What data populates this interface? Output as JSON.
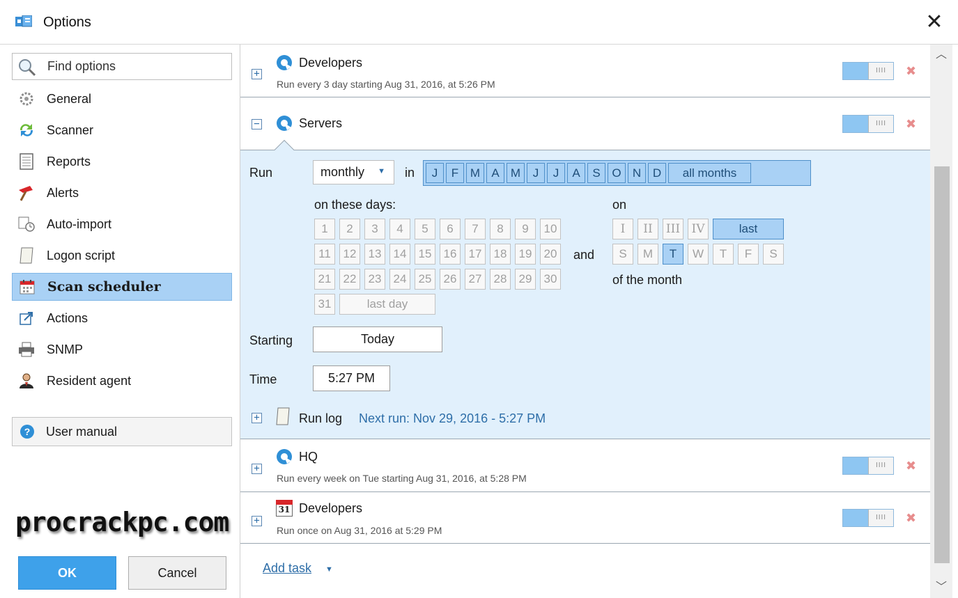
{
  "window": {
    "title": "Options",
    "close_symbol": "✕"
  },
  "sidebar": {
    "search_placeholder": "Find options",
    "items": [
      {
        "label": "General",
        "icon": "gear-icon"
      },
      {
        "label": "Scanner",
        "icon": "scanner-icon"
      },
      {
        "label": "Reports",
        "icon": "report-icon"
      },
      {
        "label": "Alerts",
        "icon": "alert-icon"
      },
      {
        "label": "Auto-import",
        "icon": "auto-import-icon"
      },
      {
        "label": "Logon script",
        "icon": "script-icon"
      },
      {
        "label": "Scan scheduler",
        "icon": "calendar-icon",
        "active": true
      },
      {
        "label": "Actions",
        "icon": "actions-icon"
      },
      {
        "label": "SNMP",
        "icon": "printer-icon"
      },
      {
        "label": "Resident agent",
        "icon": "agent-icon"
      }
    ],
    "user_manual": "User manual",
    "watermark": "procrackpc.com"
  },
  "buttons": {
    "ok": "OK",
    "cancel": "Cancel"
  },
  "tasks": [
    {
      "name": "Developers",
      "desc": "Run every 3 day starting Aug 31, 2016, at 5:26 PM",
      "icon": "refresh-icon",
      "expander": "+",
      "toggle": "IIII",
      "delete": "✖"
    },
    {
      "name": "Servers",
      "icon": "refresh-icon",
      "expander": "−",
      "toggle": "IIII",
      "delete": "✖"
    },
    {
      "name": "HQ",
      "desc": "Run every week on Tue starting Aug 31, 2016, at 5:28 PM",
      "icon": "refresh-icon",
      "expander": "+",
      "toggle": "IIII",
      "delete": "✖"
    },
    {
      "name": "Developers",
      "desc": "Run once on Aug 31, 2016 at 5:29 PM",
      "icon": "calendar-icon",
      "calendar_day": "31",
      "expander": "+",
      "toggle": "IIII",
      "delete": "✖"
    }
  ],
  "schedule": {
    "run_label": "Run",
    "frequency": "monthly",
    "in_label": "in",
    "months": [
      "J",
      "F",
      "M",
      "A",
      "M",
      "J",
      "J",
      "A",
      "S",
      "O",
      "N",
      "D"
    ],
    "all_months": "all months",
    "days_label": "on these days:",
    "days": [
      "1",
      "2",
      "3",
      "4",
      "5",
      "6",
      "7",
      "8",
      "9",
      "10",
      "11",
      "12",
      "13",
      "14",
      "15",
      "16",
      "17",
      "18",
      "19",
      "20",
      "21",
      "22",
      "23",
      "24",
      "25",
      "26",
      "27",
      "28",
      "29",
      "30",
      "31"
    ],
    "last_day": "last day",
    "and_label": "and",
    "on_label": "on",
    "ordinals": [
      "I",
      "II",
      "III",
      "IV"
    ],
    "last_label": "last",
    "weekdays": [
      "S",
      "M",
      "T",
      "W",
      "T",
      "F",
      "S"
    ],
    "selected_weekday_index": 2,
    "of_month": "of the month",
    "starting_label": "Starting",
    "starting_value": "Today",
    "time_label": "Time",
    "time_value": "5:27 PM",
    "run_log": "Run log",
    "run_log_expander": "+",
    "next_run": "Next run: Nov 29, 2016 - 5:27 PM"
  },
  "add_task": "Add task",
  "add_task_caret": "▼",
  "dropdown_caret": "▼",
  "scroll": {
    "up": "︿",
    "down": "﹀"
  },
  "colors": {
    "accent": "#3ea1ea",
    "selection": "#a9d1f5",
    "panel": "#e1f0fc",
    "link": "#2e6ea8"
  }
}
